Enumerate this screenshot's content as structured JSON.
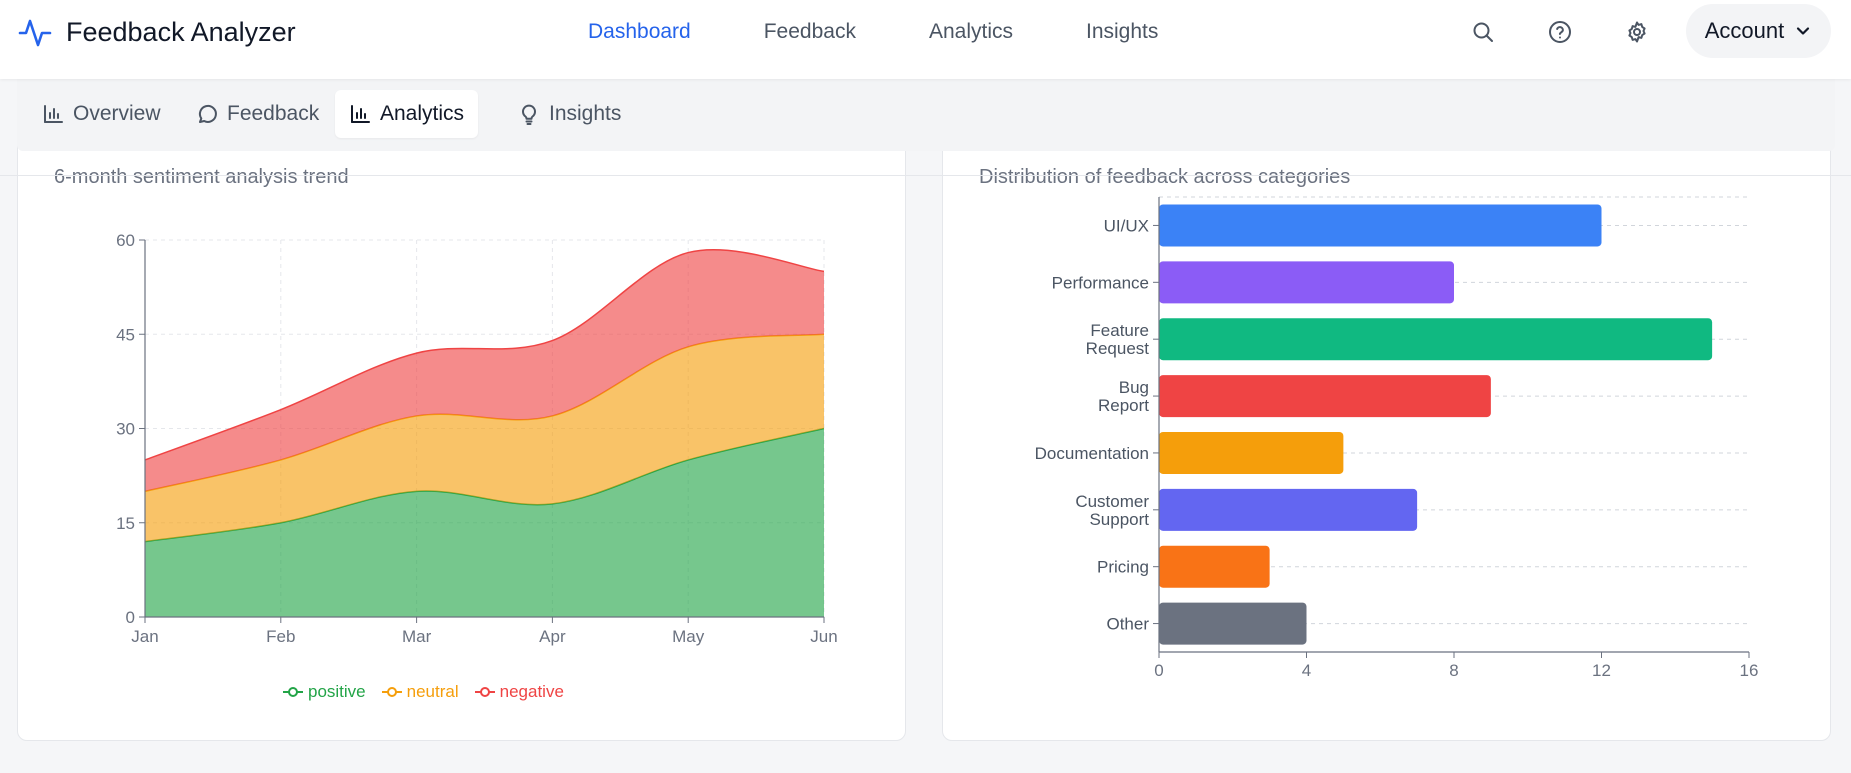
{
  "app": {
    "title": "Feedback Analyzer"
  },
  "nav": [
    {
      "label": "Dashboard",
      "active": true
    },
    {
      "label": "Feedback",
      "active": false
    },
    {
      "label": "Analytics",
      "active": false
    },
    {
      "label": "Insights",
      "active": false
    }
  ],
  "header_icons": [
    "search-icon",
    "help-icon",
    "gear-icon"
  ],
  "account": {
    "label": "Account"
  },
  "subtabs": [
    {
      "label": "Overview",
      "icon": "bar-chart-icon",
      "active": false
    },
    {
      "label": "Feedback",
      "icon": "message-icon",
      "active": false
    },
    {
      "label": "Analytics",
      "icon": "bar-chart-icon",
      "active": true
    },
    {
      "label": "Insights",
      "icon": "lightbulb-icon",
      "active": false
    }
  ],
  "colors": {
    "accent": "#2563eb",
    "positive": "#16a34a",
    "neutral": "#f59e0b",
    "negative": "#ef4444"
  },
  "sentiment_card": {
    "subtitle": "6-month sentiment analysis trend"
  },
  "category_card": {
    "subtitle": "Distribution of feedback across categories"
  },
  "chart_data": [
    {
      "type": "area",
      "stacked": true,
      "categories": [
        "Jan",
        "Feb",
        "Mar",
        "Apr",
        "May",
        "Jun"
      ],
      "series": [
        {
          "name": "positive",
          "values": [
            12,
            15,
            20,
            18,
            25,
            30
          ],
          "color": "#22a447"
        },
        {
          "name": "neutral",
          "values": [
            8,
            10,
            12,
            14,
            18,
            15
          ],
          "color": "#f59e0b"
        },
        {
          "name": "negative",
          "values": [
            5,
            8,
            10,
            12,
            15,
            10
          ],
          "color": "#ef4444"
        }
      ],
      "ylim": [
        0,
        60
      ],
      "yticks": [
        0,
        15,
        30,
        45,
        60
      ],
      "grid": true,
      "legend": "bottom"
    },
    {
      "type": "bar",
      "orientation": "horizontal",
      "categories": [
        "UI/UX",
        "Performance",
        "Feature Request",
        "Bug Report",
        "Documentation",
        "Customer Support",
        "Pricing",
        "Other"
      ],
      "values": [
        12,
        8,
        15,
        9,
        5,
        7,
        3,
        4
      ],
      "colors": [
        "#3b82f6",
        "#8b5cf6",
        "#10b981",
        "#ef4444",
        "#f59e0b",
        "#6366f1",
        "#f97316",
        "#6b7280"
      ],
      "xlim": [
        0,
        16
      ],
      "xticks": [
        0,
        4,
        8,
        12,
        16
      ],
      "grid": true
    }
  ]
}
